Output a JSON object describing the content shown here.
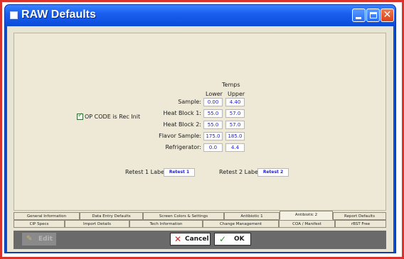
{
  "window": {
    "title": "RAW Defaults"
  },
  "op_code_checkbox": {
    "label": "OP CODE is Rec Init",
    "checked": true
  },
  "temps": {
    "heading": "Temps",
    "lower_label": "Lower",
    "upper_label": "Upper",
    "rows": [
      {
        "label": "Sample:",
        "lower": "0.00",
        "upper": "4.40"
      },
      {
        "label": "Heat Block 1:",
        "lower": "55.0",
        "upper": "57.0"
      },
      {
        "label": "Heat Block 2:",
        "lower": "55.0",
        "upper": "57.0"
      },
      {
        "label": "Flavor Sample:",
        "lower": "175.0",
        "upper": "185.0"
      },
      {
        "label": "Refrigerator:",
        "lower": "0.0",
        "upper": "4.4"
      }
    ]
  },
  "retest": {
    "retest1_label": "Retest 1 Label:",
    "retest1_value": "Retest 1",
    "retest2_label": "Retest 2 Label:",
    "retest2_value": "Retest 2"
  },
  "tabs": {
    "row1": [
      "General Information",
      "Data Entry Defaults",
      "Screen Colors & Settings",
      "Antibiotic 1",
      "Antibiotic 2",
      "Report Defaults"
    ],
    "row2": [
      "CIP Specs",
      "Import Details",
      "Tech Information",
      "Change Management",
      "COA / Manifest",
      "rBST Free"
    ],
    "active": "Antibiotic 2"
  },
  "buttons": {
    "edit": "Edit",
    "cancel": "Cancel",
    "ok": "OK"
  },
  "colors": {
    "title_bar": "#0b4ad8",
    "field_text": "#1a1ae0",
    "cancel_icon": "#e02020",
    "ok_icon": "#2c9a2c"
  }
}
